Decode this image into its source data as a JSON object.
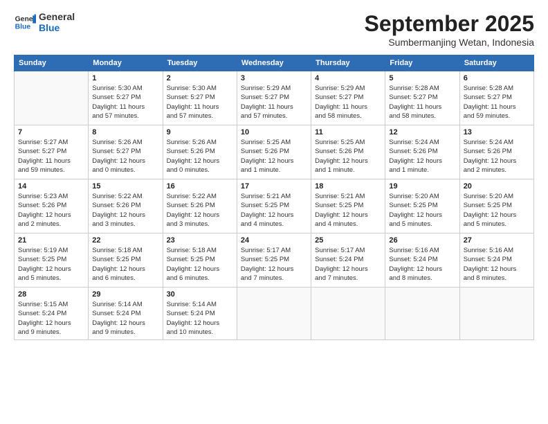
{
  "logo": {
    "general": "General",
    "blue": "Blue"
  },
  "title": "September 2025",
  "subtitle": "Sumbermanjing Wetan, Indonesia",
  "days_of_week": [
    "Sunday",
    "Monday",
    "Tuesday",
    "Wednesday",
    "Thursday",
    "Friday",
    "Saturday"
  ],
  "weeks": [
    [
      {
        "day": "",
        "info": ""
      },
      {
        "day": "1",
        "info": "Sunrise: 5:30 AM\nSunset: 5:27 PM\nDaylight: 11 hours\nand 57 minutes."
      },
      {
        "day": "2",
        "info": "Sunrise: 5:30 AM\nSunset: 5:27 PM\nDaylight: 11 hours\nand 57 minutes."
      },
      {
        "day": "3",
        "info": "Sunrise: 5:29 AM\nSunset: 5:27 PM\nDaylight: 11 hours\nand 57 minutes."
      },
      {
        "day": "4",
        "info": "Sunrise: 5:29 AM\nSunset: 5:27 PM\nDaylight: 11 hours\nand 58 minutes."
      },
      {
        "day": "5",
        "info": "Sunrise: 5:28 AM\nSunset: 5:27 PM\nDaylight: 11 hours\nand 58 minutes."
      },
      {
        "day": "6",
        "info": "Sunrise: 5:28 AM\nSunset: 5:27 PM\nDaylight: 11 hours\nand 59 minutes."
      }
    ],
    [
      {
        "day": "7",
        "info": "Sunrise: 5:27 AM\nSunset: 5:27 PM\nDaylight: 11 hours\nand 59 minutes."
      },
      {
        "day": "8",
        "info": "Sunrise: 5:26 AM\nSunset: 5:27 PM\nDaylight: 12 hours\nand 0 minutes."
      },
      {
        "day": "9",
        "info": "Sunrise: 5:26 AM\nSunset: 5:26 PM\nDaylight: 12 hours\nand 0 minutes."
      },
      {
        "day": "10",
        "info": "Sunrise: 5:25 AM\nSunset: 5:26 PM\nDaylight: 12 hours\nand 1 minute."
      },
      {
        "day": "11",
        "info": "Sunrise: 5:25 AM\nSunset: 5:26 PM\nDaylight: 12 hours\nand 1 minute."
      },
      {
        "day": "12",
        "info": "Sunrise: 5:24 AM\nSunset: 5:26 PM\nDaylight: 12 hours\nand 1 minute."
      },
      {
        "day": "13",
        "info": "Sunrise: 5:24 AM\nSunset: 5:26 PM\nDaylight: 12 hours\nand 2 minutes."
      }
    ],
    [
      {
        "day": "14",
        "info": "Sunrise: 5:23 AM\nSunset: 5:26 PM\nDaylight: 12 hours\nand 2 minutes."
      },
      {
        "day": "15",
        "info": "Sunrise: 5:22 AM\nSunset: 5:26 PM\nDaylight: 12 hours\nand 3 minutes."
      },
      {
        "day": "16",
        "info": "Sunrise: 5:22 AM\nSunset: 5:26 PM\nDaylight: 12 hours\nand 3 minutes."
      },
      {
        "day": "17",
        "info": "Sunrise: 5:21 AM\nSunset: 5:25 PM\nDaylight: 12 hours\nand 4 minutes."
      },
      {
        "day": "18",
        "info": "Sunrise: 5:21 AM\nSunset: 5:25 PM\nDaylight: 12 hours\nand 4 minutes."
      },
      {
        "day": "19",
        "info": "Sunrise: 5:20 AM\nSunset: 5:25 PM\nDaylight: 12 hours\nand 5 minutes."
      },
      {
        "day": "20",
        "info": "Sunrise: 5:20 AM\nSunset: 5:25 PM\nDaylight: 12 hours\nand 5 minutes."
      }
    ],
    [
      {
        "day": "21",
        "info": "Sunrise: 5:19 AM\nSunset: 5:25 PM\nDaylight: 12 hours\nand 5 minutes."
      },
      {
        "day": "22",
        "info": "Sunrise: 5:18 AM\nSunset: 5:25 PM\nDaylight: 12 hours\nand 6 minutes."
      },
      {
        "day": "23",
        "info": "Sunrise: 5:18 AM\nSunset: 5:25 PM\nDaylight: 12 hours\nand 6 minutes."
      },
      {
        "day": "24",
        "info": "Sunrise: 5:17 AM\nSunset: 5:25 PM\nDaylight: 12 hours\nand 7 minutes."
      },
      {
        "day": "25",
        "info": "Sunrise: 5:17 AM\nSunset: 5:24 PM\nDaylight: 12 hours\nand 7 minutes."
      },
      {
        "day": "26",
        "info": "Sunrise: 5:16 AM\nSunset: 5:24 PM\nDaylight: 12 hours\nand 8 minutes."
      },
      {
        "day": "27",
        "info": "Sunrise: 5:16 AM\nSunset: 5:24 PM\nDaylight: 12 hours\nand 8 minutes."
      }
    ],
    [
      {
        "day": "28",
        "info": "Sunrise: 5:15 AM\nSunset: 5:24 PM\nDaylight: 12 hours\nand 9 minutes."
      },
      {
        "day": "29",
        "info": "Sunrise: 5:14 AM\nSunset: 5:24 PM\nDaylight: 12 hours\nand 9 minutes."
      },
      {
        "day": "30",
        "info": "Sunrise: 5:14 AM\nSunset: 5:24 PM\nDaylight: 12 hours\nand 10 minutes."
      },
      {
        "day": "",
        "info": ""
      },
      {
        "day": "",
        "info": ""
      },
      {
        "day": "",
        "info": ""
      },
      {
        "day": "",
        "info": ""
      }
    ]
  ]
}
